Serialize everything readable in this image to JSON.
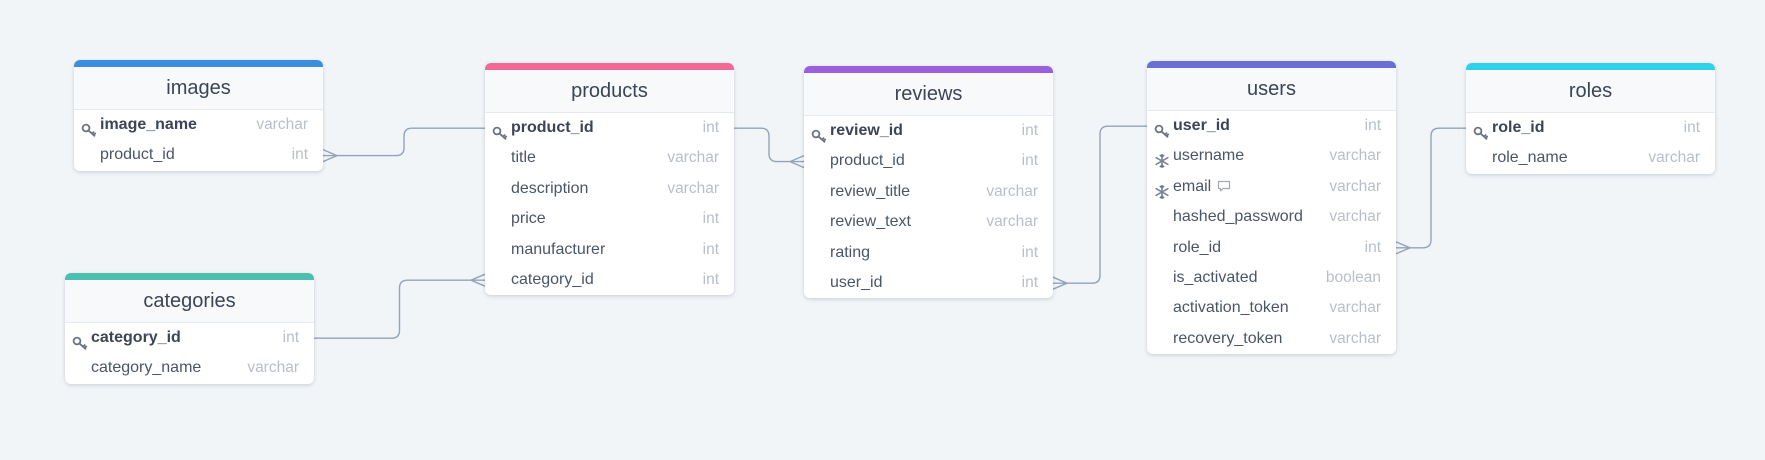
{
  "colors": {
    "background": "#f1f5f8",
    "connector": "#94a3b8",
    "images": "#3b8ede",
    "products": "#f06a95",
    "reviews": "#9a5fdd",
    "users": "#6b6fd4",
    "roles": "#2ed3ea",
    "categories": "#4cc0b0"
  },
  "tables": [
    {
      "id": "images",
      "name": "images",
      "color": "#3b8ede",
      "fields": [
        {
          "name": "image_name",
          "type": "varchar",
          "pk": true
        },
        {
          "name": "product_id",
          "type": "int"
        }
      ]
    },
    {
      "id": "products",
      "name": "products",
      "color": "#f06a95",
      "fields": [
        {
          "name": "product_id",
          "type": "int",
          "pk": true
        },
        {
          "name": "title",
          "type": "varchar"
        },
        {
          "name": "description",
          "type": "varchar"
        },
        {
          "name": "price",
          "type": "int"
        },
        {
          "name": "manufacturer",
          "type": "int"
        },
        {
          "name": "category_id",
          "type": "int"
        }
      ]
    },
    {
      "id": "reviews",
      "name": "reviews",
      "color": "#9a5fdd",
      "fields": [
        {
          "name": "review_id",
          "type": "int",
          "pk": true
        },
        {
          "name": "product_id",
          "type": "int"
        },
        {
          "name": "review_title",
          "type": "varchar"
        },
        {
          "name": "review_text",
          "type": "varchar"
        },
        {
          "name": "rating",
          "type": "int"
        },
        {
          "name": "user_id",
          "type": "int"
        }
      ]
    },
    {
      "id": "users",
      "name": "users",
      "color": "#6b6fd4",
      "fields": [
        {
          "name": "user_id",
          "type": "int",
          "pk": true
        },
        {
          "name": "username",
          "type": "varchar",
          "unique": true
        },
        {
          "name": "email",
          "type": "varchar",
          "unique": true,
          "note": true
        },
        {
          "name": "hashed_password",
          "type": "varchar"
        },
        {
          "name": "role_id",
          "type": "int"
        },
        {
          "name": "is_activated",
          "type": "boolean"
        },
        {
          "name": "activation_token",
          "type": "varchar"
        },
        {
          "name": "recovery_token",
          "type": "varchar"
        }
      ]
    },
    {
      "id": "roles",
      "name": "roles",
      "color": "#2ed3ea",
      "fields": [
        {
          "name": "role_id",
          "type": "int",
          "pk": true
        },
        {
          "name": "role_name",
          "type": "varchar"
        }
      ]
    },
    {
      "id": "categories",
      "name": "categories",
      "color": "#4cc0b0",
      "fields": [
        {
          "name": "category_id",
          "type": "int",
          "pk": true
        },
        {
          "name": "category_name",
          "type": "varchar"
        }
      ]
    }
  ],
  "relationships": [
    {
      "from": "products.product_id",
      "to": "images.product_id",
      "cardinality": "one-to-many"
    },
    {
      "from": "products.product_id",
      "to": "reviews.product_id",
      "cardinality": "one-to-many"
    },
    {
      "from": "categories.category_id",
      "to": "products.category_id",
      "cardinality": "one-to-many"
    },
    {
      "from": "users.user_id",
      "to": "reviews.user_id",
      "cardinality": "one-to-many"
    },
    {
      "from": "roles.role_id",
      "to": "users.role_id",
      "cardinality": "one-to-many"
    }
  ]
}
